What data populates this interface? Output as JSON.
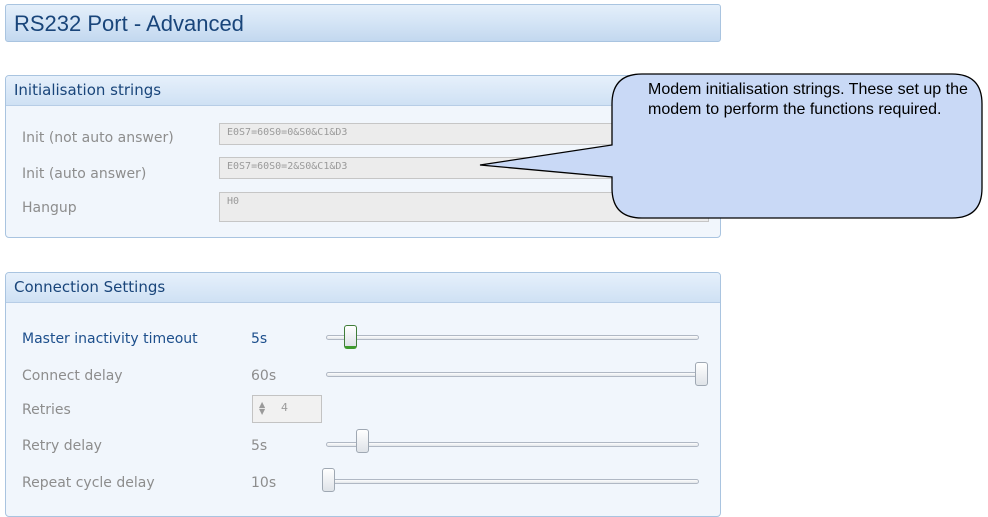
{
  "header": {
    "title": "RS232 Port - Advanced"
  },
  "init_panel": {
    "title": "Initialisation strings",
    "rows": [
      {
        "label": "Init (not auto answer)",
        "value": "E0S7=60S0=0&S0&C1&D3"
      },
      {
        "label": "Init (auto answer)",
        "value": "E0S7=60S0=2&S0&C1&D3"
      },
      {
        "label": "Hangup",
        "value": "H0"
      }
    ]
  },
  "connection_panel": {
    "title": "Connection Settings",
    "master_timeout": {
      "label": "Master inactivity timeout",
      "value": "5s",
      "slider_fraction": 0.06
    },
    "connect_delay": {
      "label": "Connect delay",
      "value": "60s",
      "slider_fraction": 1.0
    },
    "retries": {
      "label": "Retries",
      "value": "4"
    },
    "retry_delay": {
      "label": "Retry delay",
      "value": "5s",
      "slider_fraction": 0.09
    },
    "repeat_cycle_delay": {
      "label": "Repeat cycle delay",
      "value": "10s",
      "slider_fraction": 0.0
    }
  },
  "callout": {
    "text": "Modem initialisation strings. These set up the modem to perform the functions required."
  },
  "colors": {
    "title_blue": "#19457a",
    "panel_bg": "#f1f6fc",
    "callout_fill": "#c9d9f6",
    "active_green": "#3f9a2d"
  }
}
